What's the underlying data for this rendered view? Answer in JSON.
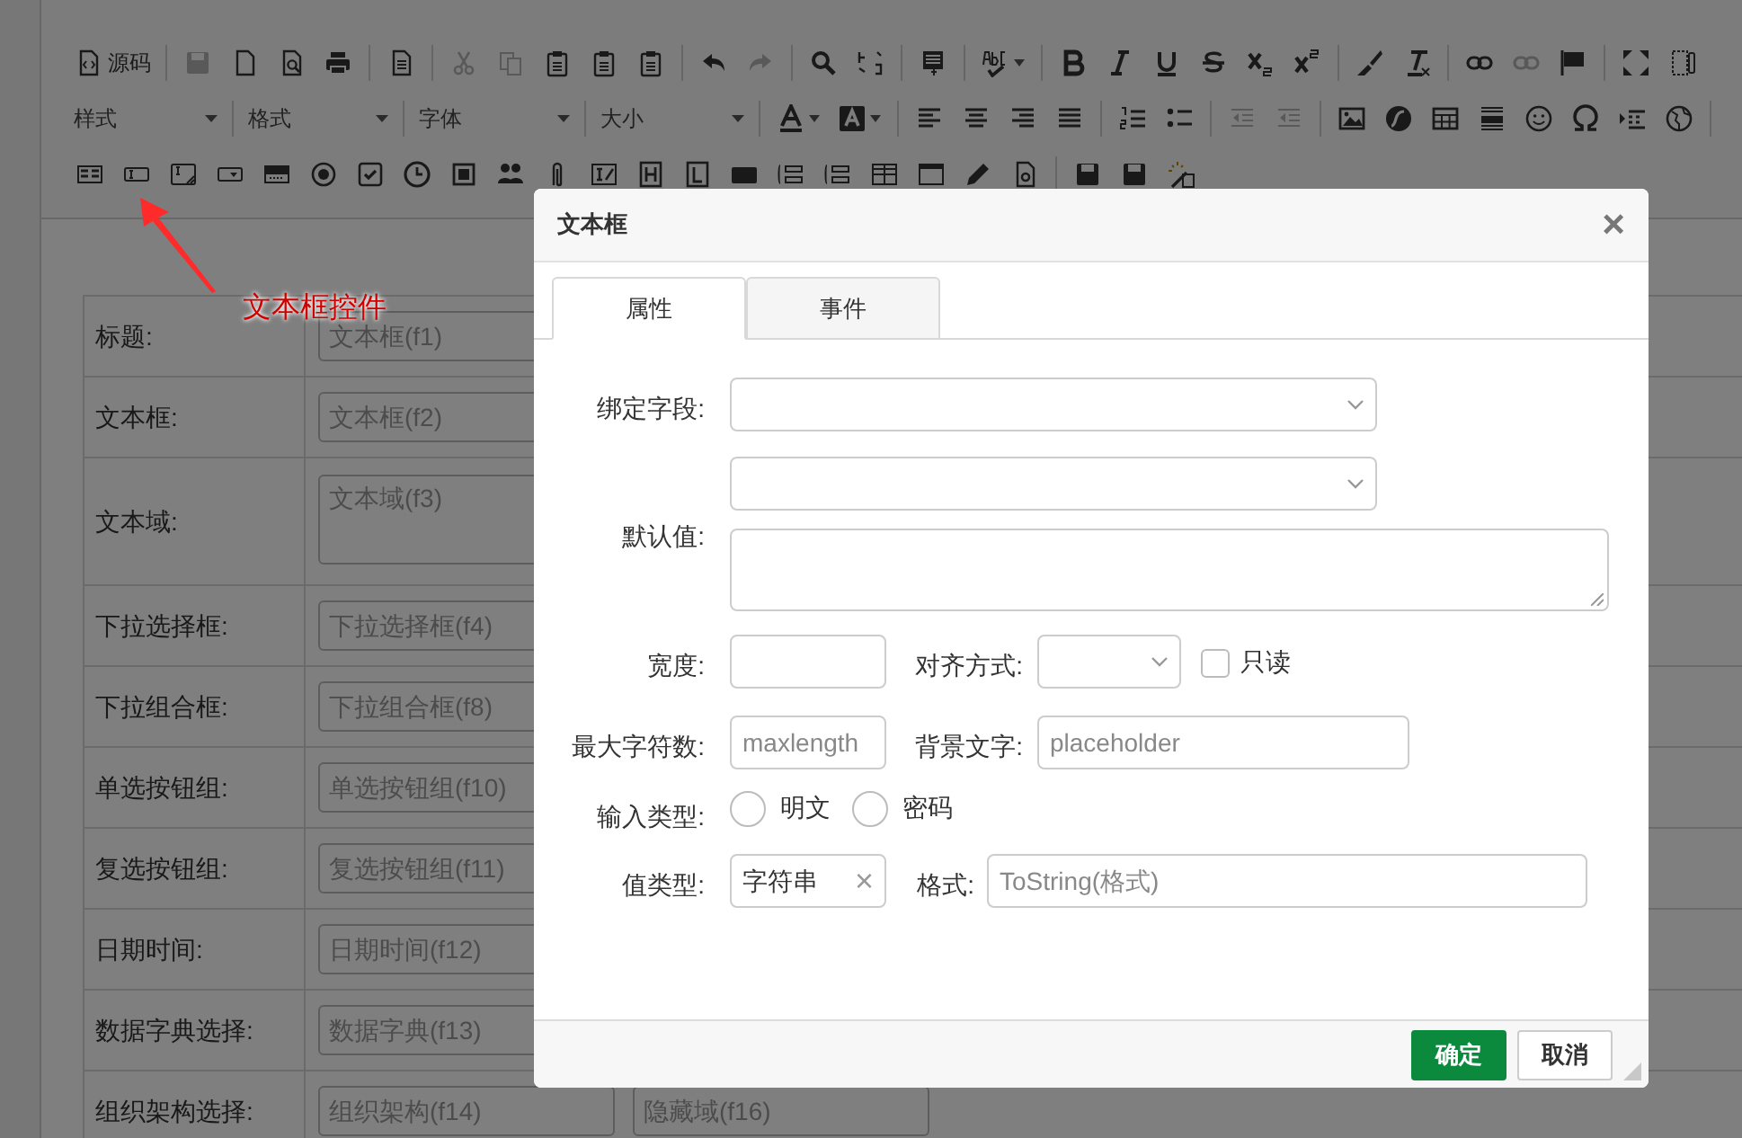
{
  "toolbar": {
    "source_button": "源码",
    "dropdowns": [
      {
        "label": "样式"
      },
      {
        "label": "格式"
      },
      {
        "label": "字体"
      },
      {
        "label": "大小"
      }
    ]
  },
  "annotation": {
    "text": "文本框控件"
  },
  "form": {
    "rows": [
      {
        "label": "标题:",
        "fields": [
          {
            "placeholder": "文本框(f1)"
          }
        ]
      },
      {
        "label": "文本框:",
        "fields": [
          {
            "placeholder": "文本框(f2)"
          }
        ]
      },
      {
        "label": "文本域:",
        "kind": "textarea",
        "fields": [
          {
            "placeholder": "文本域(f3)"
          }
        ]
      },
      {
        "label": "下拉选择框:",
        "fields": [
          {
            "placeholder": "下拉选择框(f4)"
          }
        ]
      },
      {
        "label": "下拉组合框:",
        "fields": [
          {
            "placeholder": "下拉组合框(f8)"
          }
        ]
      },
      {
        "label": "单选按钮组:",
        "fields": [
          {
            "placeholder": "单选按钮组(f10)"
          }
        ]
      },
      {
        "label": "复选按钮组:",
        "fields": [
          {
            "placeholder": "复选按钮组(f11)"
          }
        ]
      },
      {
        "label": "日期时间:",
        "fields": [
          {
            "placeholder": "日期时间(f12)"
          }
        ]
      },
      {
        "label": "数据字典选择:",
        "fields": [
          {
            "placeholder": "数据字典(f13)"
          }
        ]
      },
      {
        "label": "组织架构选择:",
        "fields": [
          {
            "placeholder": "组织架构(f14)"
          },
          {
            "placeholder": "隐藏域(f16)"
          }
        ]
      }
    ]
  },
  "dialog": {
    "title": "文本框",
    "close": "×",
    "tabs": [
      {
        "label": "属性",
        "selected": true
      },
      {
        "label": "事件",
        "selected": false
      }
    ],
    "bind_field": {
      "label": "绑定字段:"
    },
    "default_value": {
      "label": "默认值:"
    },
    "width": {
      "label": "宽度:"
    },
    "align": {
      "label": "对齐方式:"
    },
    "readonly": {
      "label": "只读",
      "checked": false
    },
    "max_length": {
      "label": "最大字符数:",
      "placeholder": "maxlength"
    },
    "placeholder_text": {
      "label": "背景文字:",
      "placeholder": "placeholder"
    },
    "input_type": {
      "label": "输入类型:",
      "options": [
        {
          "label": "明文",
          "selected": false
        },
        {
          "label": "密码",
          "selected": false
        }
      ]
    },
    "value_type": {
      "label": "值类型:",
      "value": "字符串",
      "clear": "×"
    },
    "format": {
      "label": "格式:",
      "placeholder": "ToString(格式)"
    },
    "buttons": [
      {
        "label": "确定",
        "kind": "primary"
      },
      {
        "label": "取消",
        "kind": "default"
      }
    ]
  }
}
